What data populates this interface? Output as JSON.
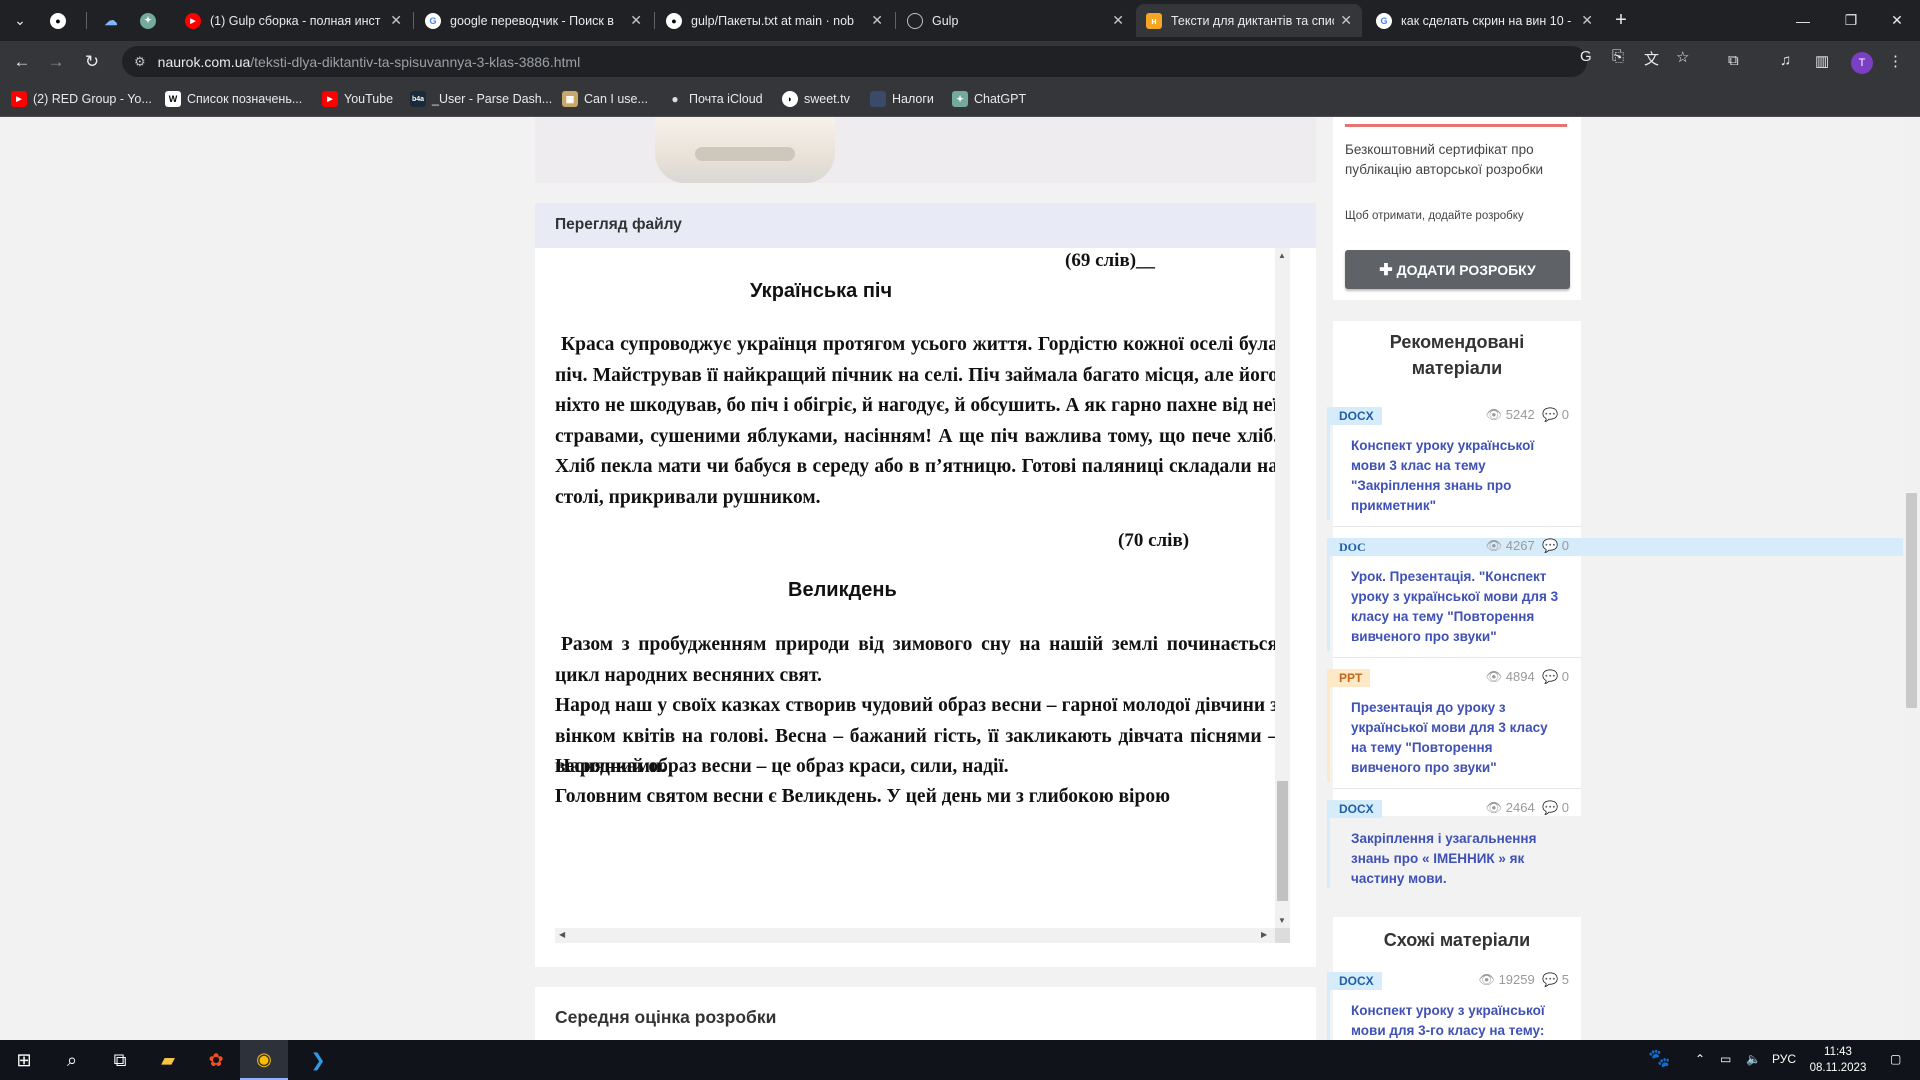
{
  "browser": {
    "tabs": [
      {
        "title": "",
        "icon": "github-icon"
      },
      {
        "title": "",
        "icon": "cloud-icon"
      },
      {
        "title": "",
        "icon": "chatgpt-icon"
      },
      {
        "title": "(1) Gulp сборка - полная инст",
        "icon": "youtube-icon"
      },
      {
        "title": "google переводчик - Поиск в",
        "icon": "google-icon"
      },
      {
        "title": "gulp/Пакеты.txt at main · nob",
        "icon": "github-icon"
      },
      {
        "title": "Gulp",
        "icon": "globe-icon"
      },
      {
        "title": "Тексти для диктантів та спису",
        "icon": "naurok-icon"
      },
      {
        "title": "как сделать скрин на вин 10 -",
        "icon": "google-icon"
      }
    ],
    "url_host": "naurok.com.ua",
    "url_path": "/teksti-dlya-diktantiv-ta-spisuvannya-3-klas-3886.html",
    "profile_letter": "T",
    "bookmarks": [
      {
        "label": "(2) RED Group - Yo...",
        "icon": "youtube-icon"
      },
      {
        "label": "Список позначень...",
        "icon": "wikipedia-icon"
      },
      {
        "label": "YouTube",
        "icon": "youtube-icon"
      },
      {
        "label": "_User - Parse Dash...",
        "icon": "back4app-icon"
      },
      {
        "label": "Can I use...",
        "icon": "caniuse-icon"
      },
      {
        "label": "Почта iCloud",
        "icon": "apple-icon"
      },
      {
        "label": "sweet.tv",
        "icon": "sweettv-icon"
      },
      {
        "label": "Налоги",
        "icon": "folder-icon"
      },
      {
        "label": "ChatGPT",
        "icon": "chatgpt-icon"
      }
    ]
  },
  "viewer": {
    "header": "Перегляд файлу",
    "doc": {
      "words_top": "(69 слів)__",
      "title1": "Українська піч",
      "para1": "Краса супроводжує українця протягом усього життя. Гордістю кожної оселі була піч. Майстрував її найкращий пічник на селі. Піч займала багато місця, але його ніхто не шкодував, бо піч і обігріє, й нагодує, й обсушить. А як гарно пахне від неї стравами, сушеними яблуками, насінням! А ще піч важлива тому, що пече хліб. Хліб пекла мати чи бабуся в середу або в п’ятницю. Готові паляниці складали на столі, прикривали рушником.",
      "words_mid": "(70 слів)",
      "title2": "Великдень",
      "para2a": "Разом з пробудженням природи від зимового сну на нашій землі починається цикл народних весняних свят.",
      "para2b": "Народ наш у своїх казках створив чудовий образ весни – гарної молодої дівчини з вінком квітів на голові. Весна – бажаний гість, її закликають дівчата піснями – веснянками.",
      "para2c": "Народний образ весни – це образ краси, сили, надії.",
      "para2d": "Головним святом весни є Великдень. У цей день ми з глибокою вірою"
    }
  },
  "rating": {
    "label": "Середня оцінка розробки"
  },
  "sidebar": {
    "cert_text": "Безкоштовний сертифікат про публікацію авторської розробки",
    "cert_sub": "Щоб отримати, додайте розробку",
    "add_button": "ДОДАТИ РОЗРОБКУ",
    "recommended": {
      "heading": "Рекомендовані матеріали",
      "items": [
        {
          "badge": "DOCX",
          "views": "5242",
          "comments": "0",
          "title": "Конспект уроку української мови 3 клас на тему \"Закріплення знань про прикметник\""
        },
        {
          "badge": "DOC",
          "views": "4267",
          "comments": "0",
          "title": "Урок. Презентація. \"Конспект уроку з української мови для 3 класу на тему \"Повторення вивченого про звуки\""
        },
        {
          "badge": "PPT",
          "views": "4894",
          "comments": "0",
          "title": "Презентація до уроку з української мови для 3 класу на тему \"Повторення вивченого про звуки\""
        },
        {
          "badge": "DOCX",
          "views": "2464",
          "comments": "0",
          "title": "Закріплення і узагальнення знань про « ІМЕННИК » як частину мови."
        }
      ]
    },
    "similar": {
      "heading": "Схожі матеріали",
      "items": [
        {
          "badge": "DOCX",
          "views": "19259",
          "comments": "5",
          "title": "Конспект уроку з української мови для 3-го класу на тему:"
        }
      ]
    }
  },
  "taskbar": {
    "lang": "РУС",
    "time": "11:43",
    "date": "08.11.2023"
  },
  "colors": {
    "link": "#3f51b5",
    "viewer_header_bg": "#e8eaf6",
    "add_button_bg": "#5f6368"
  }
}
